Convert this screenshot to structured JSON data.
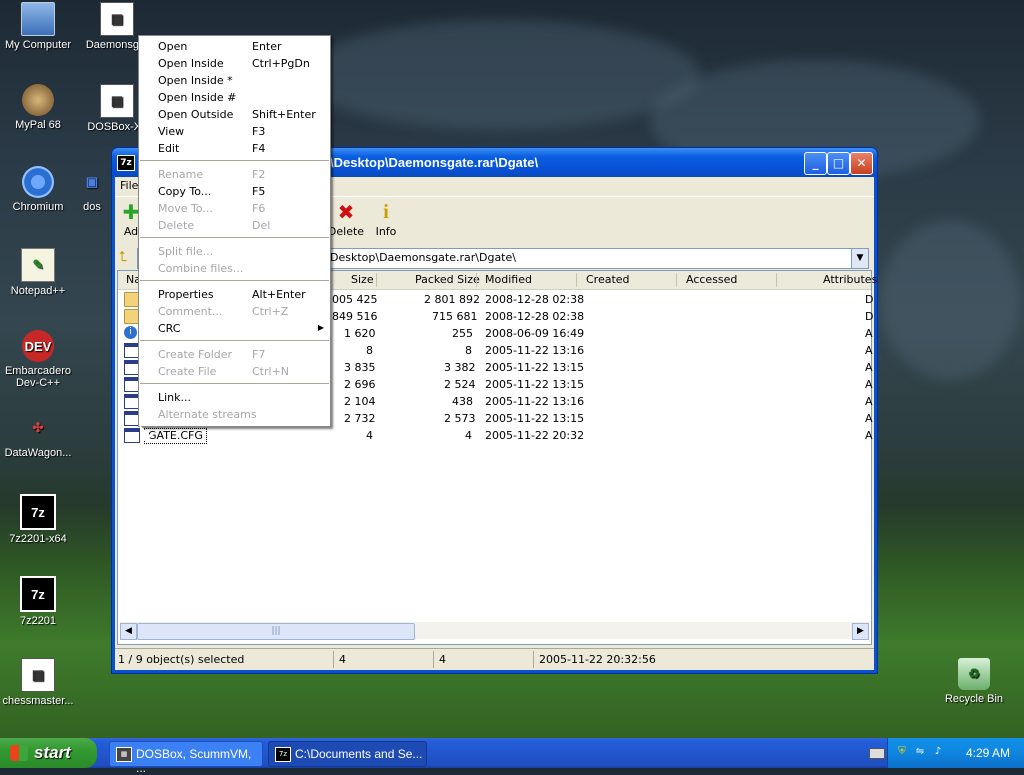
{
  "desktop": {
    "icons": [
      {
        "label": "My Computer"
      },
      {
        "label": "Daemonsgat"
      },
      {
        "label": "MyPal 68"
      },
      {
        "label": "DOSBox-X.l"
      },
      {
        "label": "Chromium"
      },
      {
        "label": "dos"
      },
      {
        "label": "Notepad++"
      },
      {
        "label": "Embarcadero Dev-C++"
      },
      {
        "label": "DataWagon..."
      },
      {
        "label": "7z2201-x64"
      },
      {
        "label": "7z2201"
      },
      {
        "label": "chessmaster..."
      },
      {
        "label": "Recycle Bin"
      }
    ]
  },
  "window": {
    "title": "\\Desktop\\Daemonsgate.rar\\Dgate\\",
    "app_icon": "7z",
    "menubar": {
      "file": "File"
    },
    "toolbar": {
      "add": "Ad",
      "delete": "Delete",
      "info": "Info"
    },
    "path": "Desktop\\Daemonsgate.rar\\Dgate\\",
    "columns": {
      "name": "Na",
      "size": "Size",
      "packed": "Packed Size",
      "modified": "Modified",
      "created": "Created",
      "accessed": "Accessed",
      "attributes": "Attributes"
    },
    "rows": [
      {
        "icon": "folder-icon",
        "size": "005 425",
        "packed": "2 801 892",
        "modified": "2008-12-28 02:38",
        "attr": "D"
      },
      {
        "icon": "folder-icon",
        "size": "849 516",
        "packed": "715 681",
        "modified": "2008-12-28 02:38",
        "attr": "D"
      },
      {
        "icon": "info-file-icon",
        "size": "1 620",
        "packed": "255",
        "modified": "2008-06-09 16:49",
        "attr": "A"
      },
      {
        "icon": "file-icon",
        "size": "8",
        "packed": "8",
        "modified": "2005-11-22 13:16",
        "attr": "A"
      },
      {
        "icon": "file-icon",
        "size": "3 835",
        "packed": "3 382",
        "modified": "2005-11-22 13:15",
        "attr": "A"
      },
      {
        "icon": "file-icon",
        "size": "2 696",
        "packed": "2 524",
        "modified": "2005-11-22 13:15",
        "attr": "A"
      },
      {
        "icon": "file-icon",
        "size": "2 104",
        "packed": "438",
        "modified": "2005-11-22 13:16",
        "attr": "A"
      },
      {
        "icon": "file-icon",
        "size": "2 732",
        "packed": "2 573",
        "modified": "2005-11-22 13:15",
        "attr": "A"
      },
      {
        "icon": "file-icon",
        "name": "GATE.CFG",
        "size": "4",
        "packed": "4",
        "modified": "2005-11-22 20:32",
        "attr": "A"
      }
    ],
    "status": {
      "selected": "1 / 9 object(s) selected",
      "size": "4",
      "packed": "4",
      "modified": "2005-11-22 20:32:56"
    }
  },
  "context_menu": {
    "items": [
      {
        "label": "Open",
        "key": "Enter"
      },
      {
        "label": "Open Inside",
        "key": "Ctrl+PgDn"
      },
      {
        "label": "Open Inside *",
        "key": ""
      },
      {
        "label": "Open Inside #",
        "key": ""
      },
      {
        "label": "Open Outside",
        "key": "Shift+Enter"
      },
      {
        "label": "View",
        "key": "F3"
      },
      {
        "label": "Edit",
        "key": "F4"
      },
      {
        "label": "Rename",
        "key": "F2"
      },
      {
        "label": "Copy To...",
        "key": "F5"
      },
      {
        "label": "Move To...",
        "key": "F6"
      },
      {
        "label": "Delete",
        "key": "Del"
      },
      {
        "label": "Split file...",
        "key": ""
      },
      {
        "label": "Combine files...",
        "key": ""
      },
      {
        "label": "Properties",
        "key": "Alt+Enter"
      },
      {
        "label": "Comment...",
        "key": "Ctrl+Z"
      },
      {
        "label": "CRC",
        "key": ""
      },
      {
        "label": "Create Folder",
        "key": "F7"
      },
      {
        "label": "Create File",
        "key": "Ctrl+N"
      },
      {
        "label": "Link...",
        "key": ""
      },
      {
        "label": "Alternate streams",
        "key": ""
      }
    ]
  },
  "taskbar": {
    "start": "start",
    "tasks": [
      {
        "label": "DOSBox, ScummVM, ..."
      },
      {
        "label": "C:\\Documents and Se..."
      }
    ],
    "clock": "4:29 AM"
  }
}
